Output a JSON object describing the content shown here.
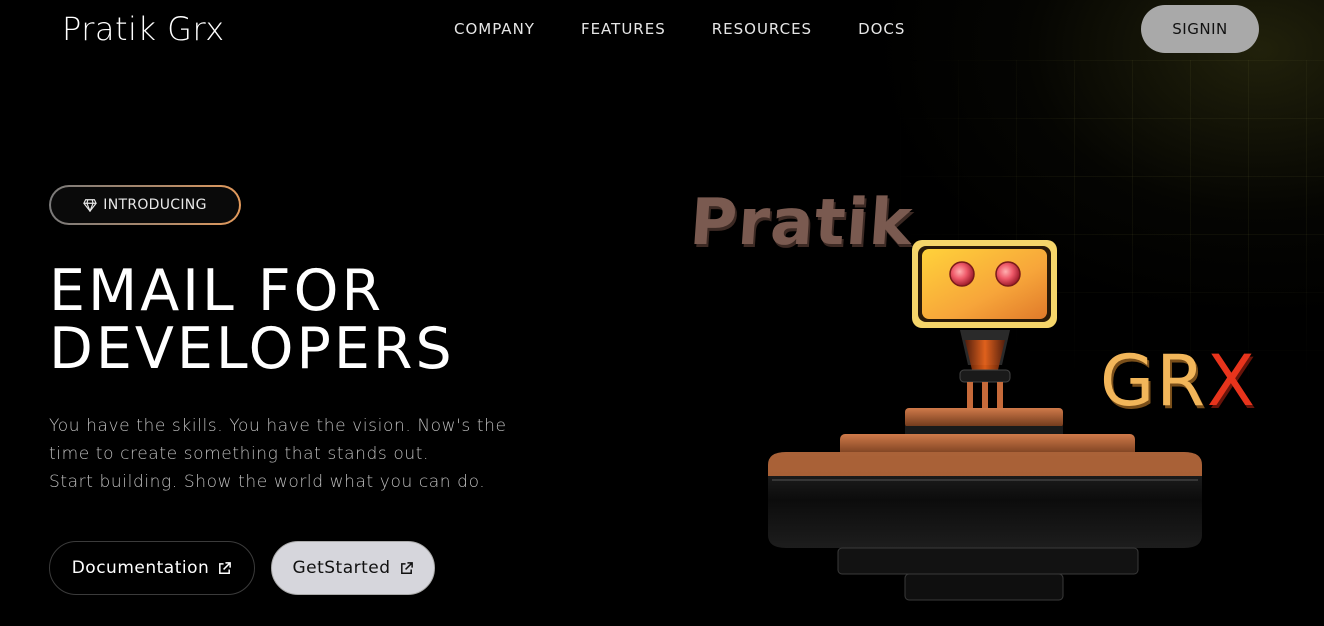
{
  "header": {
    "logo": "Pratik Grx",
    "nav": [
      "COMPANY",
      "FEATURES",
      "RESOURCES",
      "DOCS"
    ],
    "signin_label": "SIGNIN"
  },
  "hero": {
    "badge_label": "INTRODUCING",
    "headline_line1": "EMAIL FOR",
    "headline_line2": "DEVELOPERS",
    "description_line1": "You have the skills. You have the vision. Now's the",
    "description_line2": "time to create something that stands out.",
    "description_line3": "Start building. Show the world what you can do.",
    "documentation_label": "Documentation",
    "get_started_label": "GetStarted"
  },
  "artwork": {
    "word_pratik": "Pratik",
    "word_grx_gr": "GR",
    "word_grx_x": "X"
  },
  "colors": {
    "background": "#000000",
    "signin_bg": "#a9a9a9",
    "get_started_bg": "#d6d6dc",
    "accent_orange": "#e39a5c",
    "robot_yellow": "#f2b65a",
    "grx_red": "#e8341c"
  },
  "icons": {
    "badge": "diamond-icon",
    "documentation": "external-link-icon",
    "get_started": "external-link-icon"
  }
}
